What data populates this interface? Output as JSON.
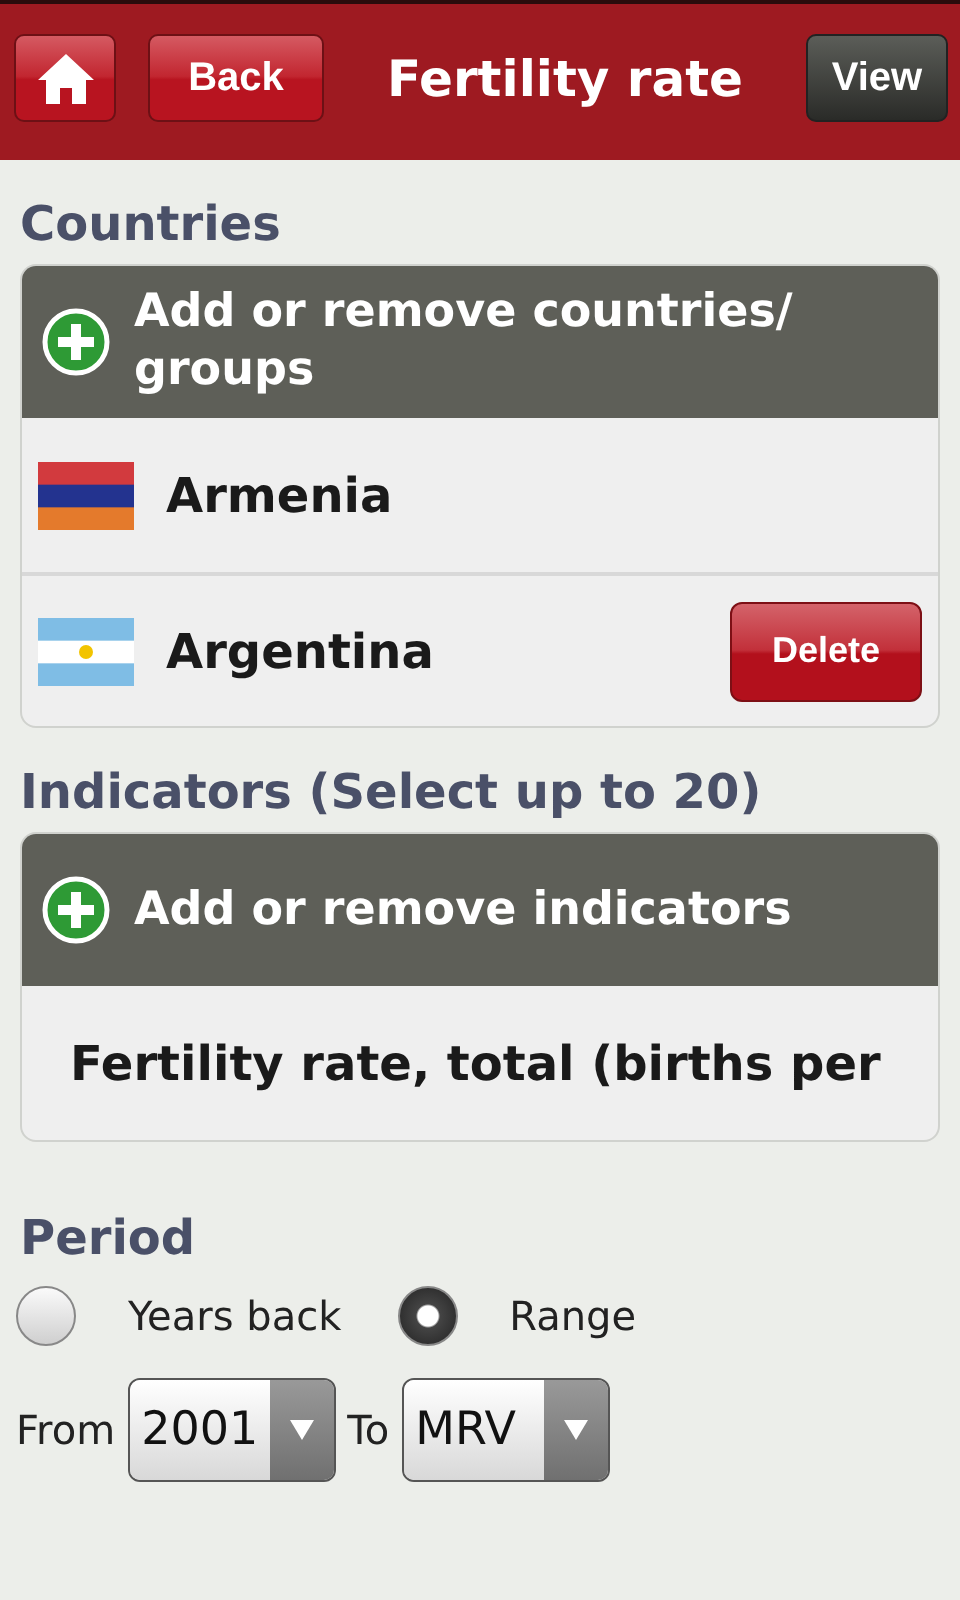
{
  "header": {
    "back_label": "Back",
    "title": "Fertility rate",
    "view_label": "View"
  },
  "countries": {
    "heading": "Countries",
    "add_label": "Add or remove countries/ groups",
    "items": [
      {
        "name": "Armenia",
        "kind": "tricolor"
      },
      {
        "name": "Argentina",
        "kind": "sun",
        "delete_label": "Delete"
      }
    ]
  },
  "indicators": {
    "heading": "Indicators (Select up to 20)",
    "add_label": "Add or remove indicators",
    "items": [
      {
        "name": "Fertility rate, total (births per"
      }
    ]
  },
  "period": {
    "heading": "Period",
    "options": [
      {
        "label": "Years back",
        "selected": false
      },
      {
        "label": "Range",
        "selected": true
      }
    ],
    "from_label": "From",
    "from_value": "2001",
    "to_label": "To",
    "to_value": "MRV"
  }
}
